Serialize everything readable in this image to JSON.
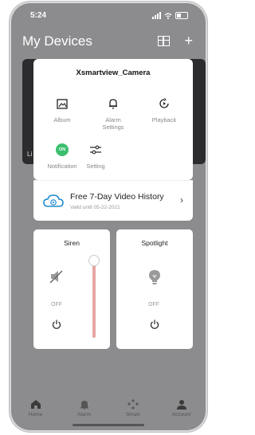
{
  "status_bar": {
    "time": "5:24"
  },
  "header": {
    "title": "My Devices"
  },
  "background_tile": {
    "label": "Li"
  },
  "device_card": {
    "name": "Xsmartview_Camera",
    "options": [
      {
        "label": "Album",
        "icon": "image-icon"
      },
      {
        "label": "Alarm Settings",
        "icon": "bell-icon"
      },
      {
        "label": "Playback",
        "icon": "playback-icon"
      },
      {
        "label": "Notification",
        "icon": "on-toggle-icon",
        "badge": "ON"
      },
      {
        "label": "Setting",
        "icon": "sliders-icon"
      }
    ]
  },
  "history": {
    "title": "Free 7-Day Video History",
    "subtitle": "Valid until 05-22-2021"
  },
  "siren": {
    "title": "Siren",
    "state": "OFF",
    "level": 1.0,
    "accent": "#e8a4a4"
  },
  "spotlight": {
    "title": "Spotlight",
    "state": "OFF"
  },
  "tabs": [
    {
      "label": "Home",
      "icon": "home-icon"
    },
    {
      "label": "Alarm",
      "icon": "alarm-icon"
    },
    {
      "label": "Smart",
      "icon": "smart-icon"
    },
    {
      "label": "Account",
      "icon": "account-icon"
    }
  ],
  "colors": {
    "notification_on": "#3cbf6e",
    "overlay": "#8c8c8e"
  }
}
